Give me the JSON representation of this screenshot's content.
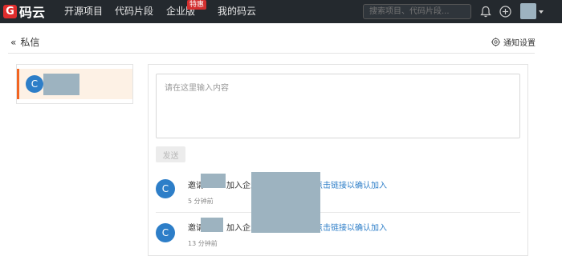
{
  "nav": {
    "logo_mark": "G",
    "logo_text": "码云",
    "items": [
      "开源项目",
      "代码片段",
      "企业版",
      "我的码云"
    ],
    "enterprise_badge": "特惠",
    "search_placeholder": "搜索项目、代码片段..."
  },
  "header": {
    "back_glyph": "«",
    "title": "私信",
    "notify_settings": "通知设置"
  },
  "conversation_list": [
    {
      "avatar_letter": "C"
    }
  ],
  "composer": {
    "placeholder": "请在这里输入内容",
    "send_label": "发送"
  },
  "messages": [
    {
      "avatar_letter": "C",
      "prefix": "邀请",
      "middle": "加入企业",
      "link": "点击链接以确认加入",
      "time": "5 分钟前"
    },
    {
      "avatar_letter": "C",
      "prefix": "邀请",
      "middle": "加入企业",
      "link": "点击链接以确认加入",
      "time": "13 分钟前"
    }
  ],
  "colors": {
    "nav_bg": "#24292e",
    "brand_red": "#e02d2d",
    "accent_orange": "#f26522",
    "avatar_blue": "#2d7ec8",
    "redaction": "#9db3c0"
  }
}
